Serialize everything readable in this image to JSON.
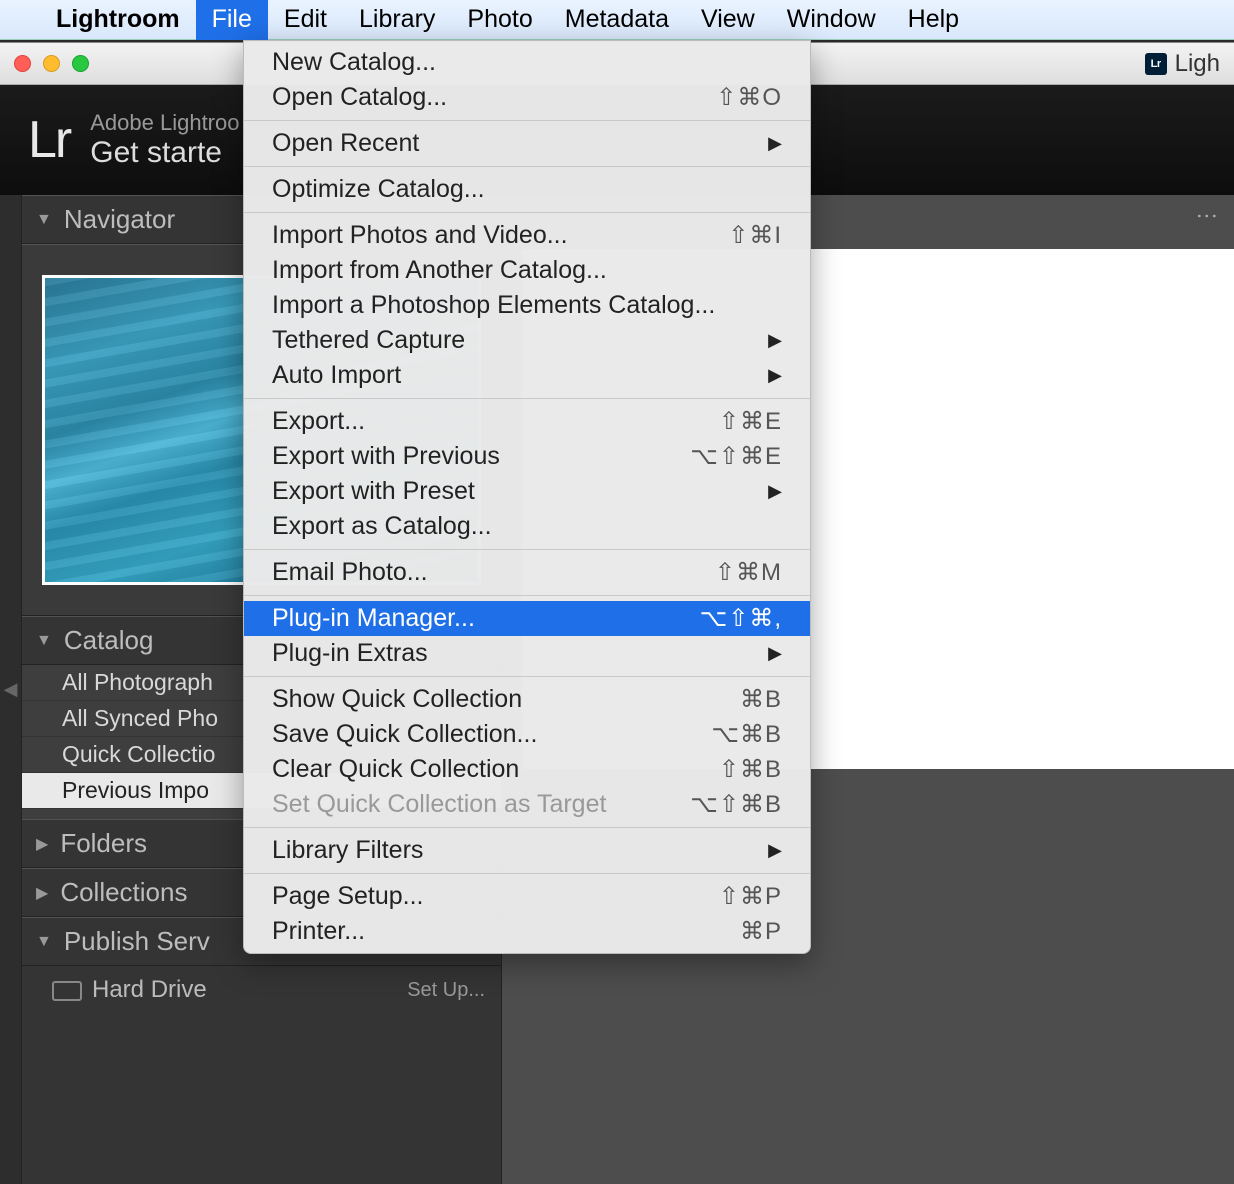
{
  "menubar": {
    "app": "Lightroom",
    "items": [
      "File",
      "Edit",
      "Library",
      "Photo",
      "Metadata",
      "View",
      "Window",
      "Help"
    ],
    "active": "File"
  },
  "titlebar": {
    "right_label": "Ligh"
  },
  "header": {
    "logo": "Lr",
    "line1": "Adobe Lightroo",
    "line2": "Get starte"
  },
  "navigator": {
    "title": "Navigator"
  },
  "catalog": {
    "title": "Catalog",
    "rows": [
      "All Photograph",
      "All Synced Pho",
      "Quick Collectio",
      "Previous Impo"
    ],
    "selected_index": 3
  },
  "folders": {
    "title": "Folders"
  },
  "collections": {
    "title": "Collections"
  },
  "publish": {
    "title": "Publish Serv",
    "row_label": "Hard Drive",
    "setup": "Set Up..."
  },
  "kebab": "⋮",
  "file_menu": [
    {
      "type": "item",
      "label": "New Catalog...",
      "shortcut": ""
    },
    {
      "type": "item",
      "label": "Open Catalog...",
      "shortcut": "⇧⌘O"
    },
    {
      "type": "sep"
    },
    {
      "type": "sub",
      "label": "Open Recent"
    },
    {
      "type": "sep"
    },
    {
      "type": "item",
      "label": "Optimize Catalog...",
      "shortcut": ""
    },
    {
      "type": "sep"
    },
    {
      "type": "item",
      "label": "Import Photos and Video...",
      "shortcut": "⇧⌘I"
    },
    {
      "type": "item",
      "label": "Import from Another Catalog...",
      "shortcut": ""
    },
    {
      "type": "item",
      "label": "Import a Photoshop Elements Catalog...",
      "shortcut": ""
    },
    {
      "type": "sub",
      "label": "Tethered Capture"
    },
    {
      "type": "sub",
      "label": "Auto Import"
    },
    {
      "type": "sep"
    },
    {
      "type": "item",
      "label": "Export...",
      "shortcut": "⇧⌘E"
    },
    {
      "type": "item",
      "label": "Export with Previous",
      "shortcut": "⌥⇧⌘E"
    },
    {
      "type": "sub",
      "label": "Export with Preset"
    },
    {
      "type": "item",
      "label": "Export as Catalog...",
      "shortcut": ""
    },
    {
      "type": "sep"
    },
    {
      "type": "item",
      "label": "Email Photo...",
      "shortcut": "⇧⌘M"
    },
    {
      "type": "sep"
    },
    {
      "type": "item",
      "label": "Plug-in Manager...",
      "shortcut": "⌥⇧⌘,",
      "highlight": true
    },
    {
      "type": "sub",
      "label": "Plug-in Extras"
    },
    {
      "type": "sep"
    },
    {
      "type": "item",
      "label": "Show Quick Collection",
      "shortcut": "⌘B"
    },
    {
      "type": "item",
      "label": "Save Quick Collection...",
      "shortcut": "⌥⌘B"
    },
    {
      "type": "item",
      "label": "Clear Quick Collection",
      "shortcut": "⇧⌘B"
    },
    {
      "type": "item",
      "label": "Set Quick Collection as Target",
      "shortcut": "⌥⇧⌘B",
      "disabled": true
    },
    {
      "type": "sep"
    },
    {
      "type": "sub",
      "label": "Library Filters"
    },
    {
      "type": "sep"
    },
    {
      "type": "item",
      "label": "Page Setup...",
      "shortcut": "⇧⌘P"
    },
    {
      "type": "item",
      "label": "Printer...",
      "shortcut": "⌘P"
    }
  ]
}
